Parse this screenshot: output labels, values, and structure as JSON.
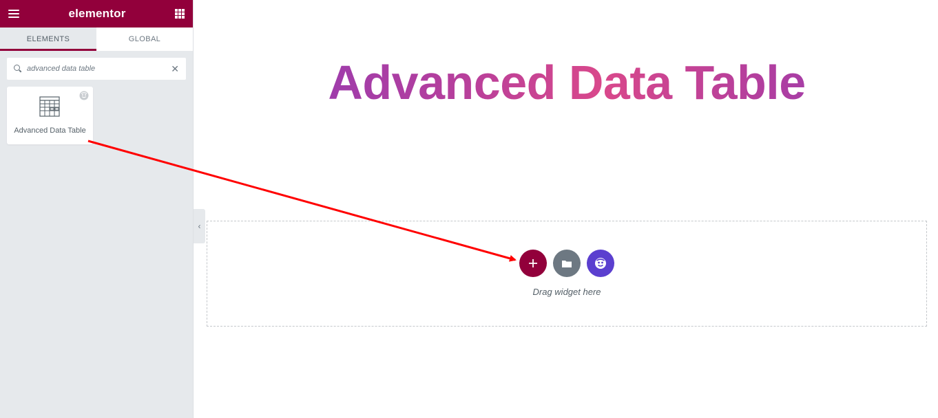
{
  "app": {
    "logo_text": "elementor",
    "brand_color": "#92003b"
  },
  "sidebar": {
    "menu_icon": "hamburger-menu-icon",
    "apps_icon": "apps-grid-icon",
    "tabs": [
      {
        "label": "ELEMENTS",
        "active": true
      },
      {
        "label": "GLOBAL",
        "active": false
      }
    ],
    "search": {
      "value": "advanced data table",
      "icon": "search-icon",
      "clear_icon": "close-icon"
    },
    "widgets": [
      {
        "label": "Advanced Data Table",
        "icon": "data-table-icon",
        "badge_icon": "pro-badge-icon"
      }
    ],
    "collapse_icon": "chevron-left-icon"
  },
  "canvas": {
    "heading": "Advanced Data Table",
    "heading_gradient": [
      "#8a3ab9",
      "#d9488b"
    ],
    "dropzone": {
      "label": "Drag widget here",
      "buttons": [
        {
          "name": "add-section",
          "icon": "plus-icon",
          "color": "#92003b"
        },
        {
          "name": "add-template",
          "icon": "folder-icon",
          "color": "#6d7882"
        },
        {
          "name": "template-library",
          "icon": "library-face-icon",
          "color": "#5b3fcf"
        }
      ]
    }
  },
  "annotation": {
    "arrow_color": "#ff0000"
  }
}
